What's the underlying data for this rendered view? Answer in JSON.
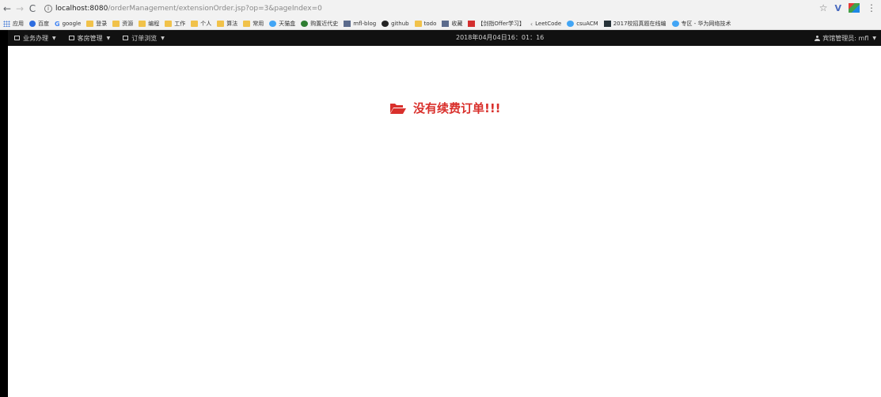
{
  "browser": {
    "back_icon": "arrow-left-icon",
    "forward_icon": "arrow-right-icon",
    "reload_icon": "reload-icon",
    "url_host": "localhost:8080",
    "url_path": "/orderManagement/extensionOrder.jsp?op=3&pageIndex=0",
    "bookmarks": [
      {
        "label": "应用",
        "icon": "apps-icon"
      },
      {
        "label": "百度",
        "icon": "paw-icon"
      },
      {
        "label": "google",
        "icon": "google-icon"
      },
      {
        "label": "登录",
        "icon": "folder-icon"
      },
      {
        "label": "资源",
        "icon": "folder-icon"
      },
      {
        "label": "编程",
        "icon": "folder-icon"
      },
      {
        "label": "工作",
        "icon": "folder-icon"
      },
      {
        "label": "个人",
        "icon": "folder-icon"
      },
      {
        "label": "算法",
        "icon": "folder-icon"
      },
      {
        "label": "常用",
        "icon": "folder-icon"
      },
      {
        "label": "天猫盒",
        "icon": "tmall-icon"
      },
      {
        "label": "购置近代史",
        "icon": "leaf-icon"
      },
      {
        "label": "mfl-blog",
        "icon": "blog-icon"
      },
      {
        "label": "github",
        "icon": "github-icon"
      },
      {
        "label": "todo",
        "icon": "folder-icon"
      },
      {
        "label": "收藏",
        "icon": "book-icon"
      },
      {
        "label": "【剑指Offer学习】",
        "icon": "csdn-icon"
      },
      {
        "label": "LeetCode",
        "icon": "leetcode-icon"
      },
      {
        "label": "csuACM",
        "icon": "acm-icon"
      },
      {
        "label": "2017校招真题在线编",
        "icon": "nowcoder-icon"
      },
      {
        "label": "专区 - 华为网络技术",
        "icon": "cloud-icon"
      }
    ]
  },
  "navbar": {
    "menus": [
      {
        "label": "业务办理",
        "icon": "list-icon"
      },
      {
        "label": "客房管理",
        "icon": "book-icon"
      },
      {
        "label": "订单浏览",
        "icon": "list-icon"
      }
    ],
    "datetime": "2018年04月04日16：01：16",
    "user_label": "宾馆管理员: mfl"
  },
  "main": {
    "message": "没有续费订单!!!",
    "icon": "folder-open-icon"
  },
  "colors": {
    "navbar_bg": "#111111",
    "message": "#d9302c"
  }
}
